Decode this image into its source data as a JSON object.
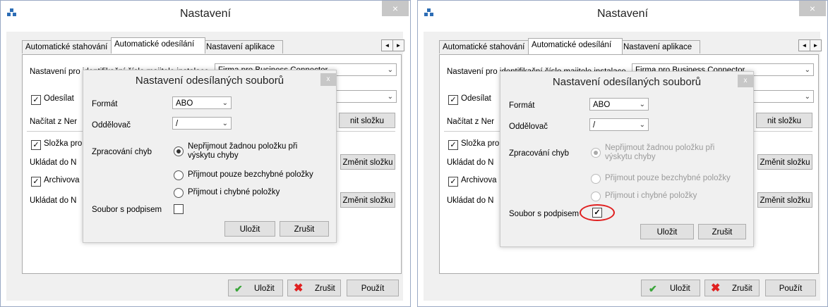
{
  "window": {
    "title": "Nastavení",
    "close": "×"
  },
  "tabs": [
    {
      "label": "Automatické stahování"
    },
    {
      "label": "Automatické odesílání"
    },
    {
      "label": "Nastavení aplikace"
    }
  ],
  "tab_scroll": {
    "left": "◄",
    "right": "►"
  },
  "settings": {
    "identification_label": "Nastavení pro identifikační číslo majitele instalace",
    "identification_value": "Firma pro Business Connector",
    "send_label": "Odesílat",
    "load_label": "Načítat z Ner",
    "change_folder_partial": "nit složku",
    "folder_label": "Složka pro",
    "save_to_label": "Ukládat do N",
    "change_folder": "Změnit složku",
    "archive_label": "Archivova",
    "save_to_label2": "Ukládat do N",
    "change_folder2": "Změnit složku"
  },
  "dialog": {
    "title": "Nastavení odesílaných souborů",
    "close": "x",
    "format_label": "Formát",
    "format_value": "ABO",
    "separator_label": "Oddělovač",
    "separator_value": "/",
    "error_label": "Zpracování chyb",
    "options": [
      "Nepřijmout žadnou položku při výskytu chyby",
      "Přijmout pouze bezchybné položky",
      "Přijmout i chybné položky"
    ],
    "signed_label": "Soubor s podpisem",
    "save": "Uložit",
    "cancel": "Zrušit"
  },
  "footer": {
    "save": "Uložit",
    "cancel": "Zrušit",
    "apply": "Použít"
  },
  "icons": {
    "check": "✔",
    "cross": "✖",
    "checkmark": "✓",
    "dropdown": "⌄"
  },
  "states": [
    {
      "send_checked": true,
      "folder_checked": true,
      "archive_checked": true,
      "error_option_selected": 0,
      "options_disabled": false,
      "signed_checked": false
    },
    {
      "send_checked": true,
      "folder_checked": true,
      "archive_checked": true,
      "error_option_selected": 0,
      "options_disabled": true,
      "signed_checked": true
    }
  ]
}
